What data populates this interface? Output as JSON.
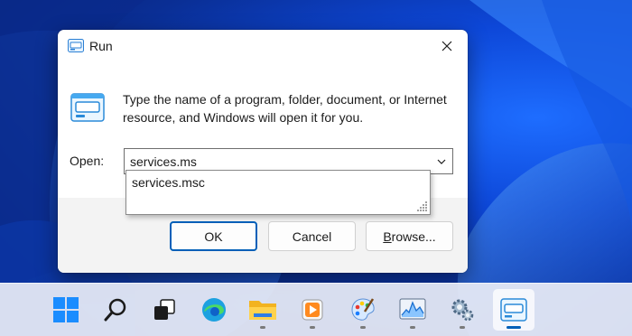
{
  "dialog": {
    "title": "Run",
    "description": "Type the name of a program, folder, document, or Internet resource, and Windows will open it for you.",
    "open_label": "Open:",
    "input_value": "services.ms",
    "suggestion": "services.msc",
    "ok_label": "OK",
    "cancel_label": "Cancel",
    "browse_label_underlined": "B",
    "browse_label_rest": "rowse..."
  },
  "taskbar": {
    "items": [
      {
        "name": "start",
        "icon": "windows-logo-icon",
        "running": false
      },
      {
        "name": "search",
        "icon": "search-icon",
        "running": false
      },
      {
        "name": "task-view",
        "icon": "task-view-icon",
        "running": false
      },
      {
        "name": "edge",
        "icon": "edge-browser-icon",
        "running": false
      },
      {
        "name": "file-explorer",
        "icon": "folder-icon",
        "running": true
      },
      {
        "name": "media-player",
        "icon": "media-player-icon",
        "running": true
      },
      {
        "name": "paint",
        "icon": "paint-palette-icon",
        "running": true
      },
      {
        "name": "resource-monitor",
        "icon": "resource-monitor-icon",
        "running": true
      },
      {
        "name": "services",
        "icon": "services-gears-icon",
        "running": true
      },
      {
        "name": "run",
        "icon": "run-icon",
        "running": true,
        "active": true
      }
    ]
  },
  "colors": {
    "accent": "#005fb8",
    "wallpaper": "#0d47d8",
    "dialog_footer": "#f3f3f3"
  }
}
